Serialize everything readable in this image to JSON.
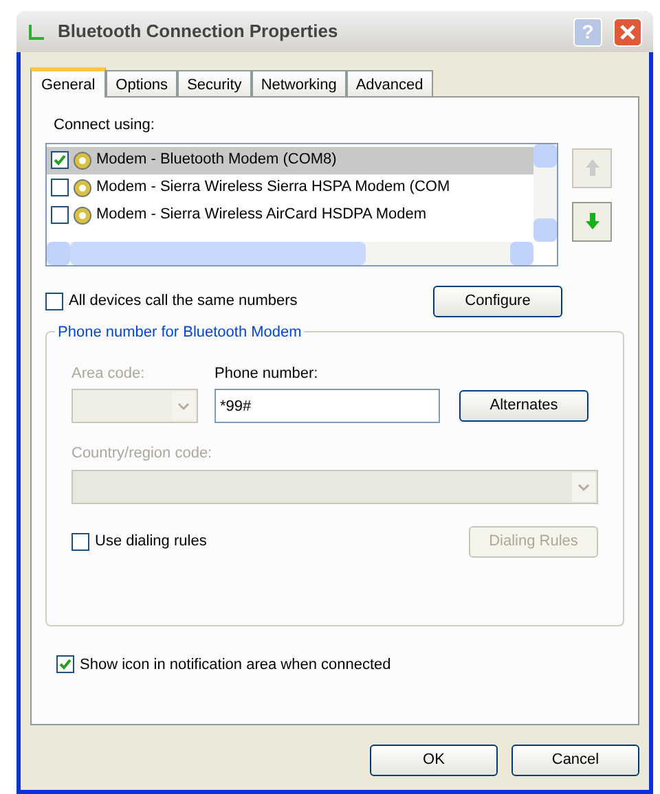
{
  "window": {
    "title": "Bluetooth Connection Properties",
    "help_button": "?"
  },
  "tabs": [
    {
      "label": "General",
      "selected": true
    },
    {
      "label": "Options",
      "selected": false
    },
    {
      "label": "Security",
      "selected": false
    },
    {
      "label": "Networking",
      "selected": false
    },
    {
      "label": "Advanced",
      "selected": false
    }
  ],
  "connect_using": {
    "label": "Connect using:",
    "devices": [
      {
        "name": "Modem - Bluetooth Modem (COM8)",
        "checked": true,
        "selected": true
      },
      {
        "name": "Modem - Sierra Wireless Sierra HSPA Modem (COM",
        "checked": false,
        "selected": false
      },
      {
        "name": "Modem - Sierra Wireless AirCard HSDPA Modem",
        "checked": false,
        "selected": false
      }
    ]
  },
  "all_devices_same_number": {
    "label": "All devices call the same numbers",
    "checked": false
  },
  "configure_button": "Configure",
  "phone_group": {
    "title": "Phone number for Bluetooth Modem",
    "area_code_label": "Area code:",
    "phone_number_label": "Phone number:",
    "phone_number": "*99#",
    "alternates_button": "Alternates",
    "country_label": "Country/region code:",
    "use_dialing_rules": {
      "label": "Use dialing rules",
      "checked": false
    },
    "dialing_rules_button": "Dialing Rules"
  },
  "show_icon": {
    "label": "Show icon in notification area when connected",
    "checked": true
  },
  "buttons": [
    "OK",
    "Cancel"
  ]
}
